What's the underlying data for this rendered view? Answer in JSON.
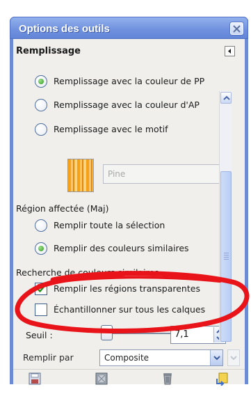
{
  "window": {
    "title": "Options des outils",
    "close_icon": "close-icon"
  },
  "fill_section": {
    "header": "Remplissage",
    "options": [
      {
        "label": "Remplissage avec la couleur de PP",
        "selected": true
      },
      {
        "label": "Remplissage avec la couleur d'AP",
        "selected": false
      },
      {
        "label": "Remplissage avec le motif",
        "selected": false
      }
    ],
    "pattern_name": "Pine"
  },
  "region_section": {
    "header": "Région affectée (Maj)",
    "options": [
      {
        "label": "Remplir toute la sélection",
        "selected": false
      },
      {
        "label": "Remplir des couleurs similaires",
        "selected": true
      }
    ]
  },
  "similar_section": {
    "header": "Recherche de couleurs similaires",
    "transparent": {
      "label": "Remplir les régions transparentes",
      "checked": true
    },
    "sample": {
      "label": "Échantillonner sur tous les calques",
      "checked": false
    },
    "threshold": {
      "label": "Seuil :",
      "value": "7,1",
      "slider_fraction": 0.03
    },
    "fill_by": {
      "label": "Remplir par",
      "value": "Composite"
    }
  },
  "toolbar": {
    "buttons": [
      "save-icon",
      "restore-icon",
      "delete-icon",
      "reset-icon"
    ]
  },
  "colors": {
    "title_bar": "#6f90de",
    "client_bg": "#f0efeb",
    "annotation": "#e8141a"
  }
}
